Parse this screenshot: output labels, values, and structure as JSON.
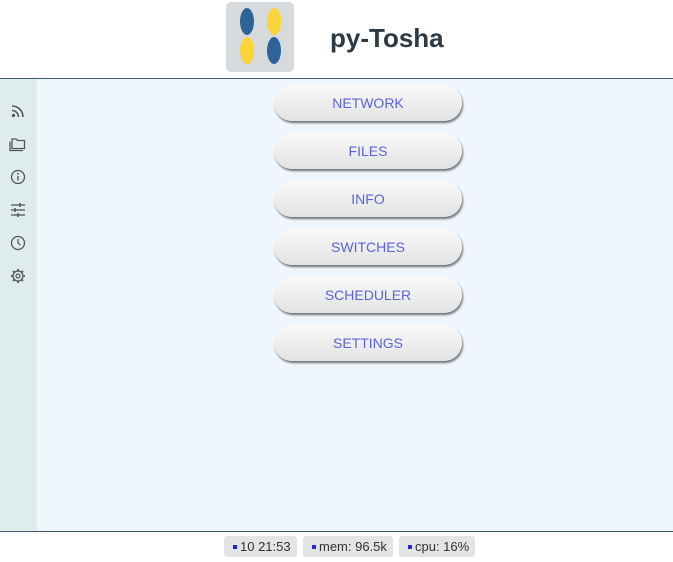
{
  "header": {
    "app_title": "py-Tosha",
    "logo": {
      "colors": [
        "#2f6397",
        "#fbd537",
        "#fbd537",
        "#2f6397"
      ]
    }
  },
  "sidebar": {
    "items": [
      {
        "icon": "rss-icon",
        "name": "sidebar-item-network"
      },
      {
        "icon": "folders-icon",
        "name": "sidebar-item-files"
      },
      {
        "icon": "info-icon",
        "name": "sidebar-item-info"
      },
      {
        "icon": "sliders-icon",
        "name": "sidebar-item-switches"
      },
      {
        "icon": "clock-icon",
        "name": "sidebar-item-scheduler"
      },
      {
        "icon": "gear-icon",
        "name": "sidebar-item-settings"
      }
    ]
  },
  "menu": {
    "network": "NETWORK",
    "files": "FILES",
    "info": "INFO",
    "switches": "SWITCHES",
    "scheduler": "SCHEDULER",
    "settings": "SETTINGS"
  },
  "status": {
    "time": "10 21:53",
    "mem": "mem: 96.5k",
    "cpu": "cpu: 16%"
  },
  "colors": {
    "accent_text": "#5c63d6",
    "sidebar_bg": "#deeceb",
    "main_bg": "#eff7fd",
    "status_dot": "#1a2bd6"
  }
}
